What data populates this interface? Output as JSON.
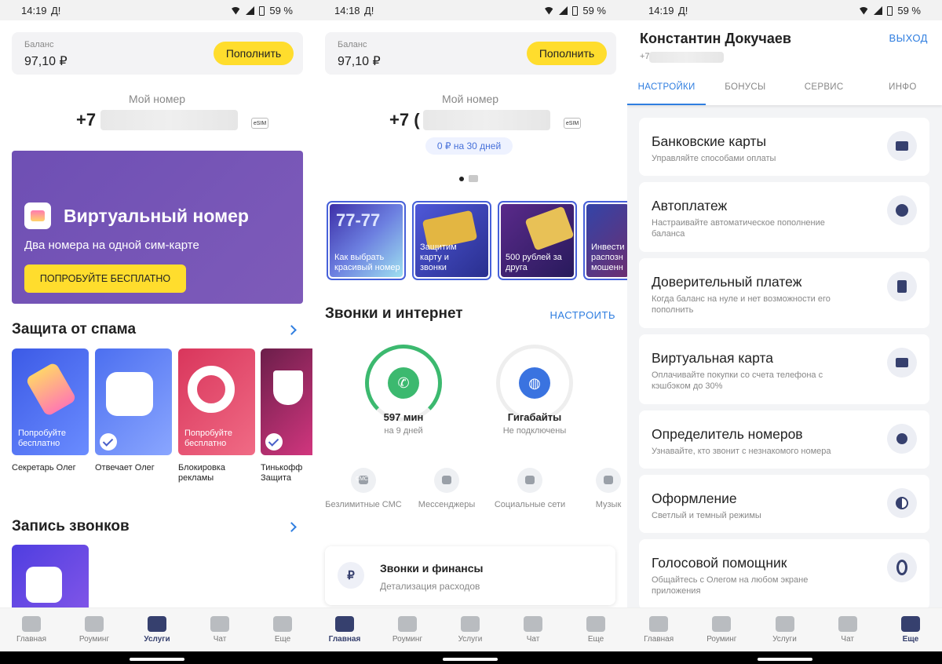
{
  "screens": [
    {
      "status": {
        "time": "14:19",
        "indicator": "Д!",
        "battery": "59 %"
      },
      "balance": {
        "label": "Баланс",
        "value": "97,10 ₽",
        "topup": "Пополнить"
      },
      "my_number": {
        "label": "Мой номер",
        "prefix": "+7",
        "esim": "eSIM"
      },
      "banner": {
        "title": "Виртуальный номер",
        "subtitle": "Два номера на одной сим-карте",
        "button": "ПОПРОБУЙТЕ БЕСПЛАТНО"
      },
      "spam": {
        "title": "Защита от спама",
        "tiles": [
          {
            "overlay": "Попробуйте бесплатно",
            "label": "Секретарь Олег"
          },
          {
            "overlay": "",
            "label": "Отвечает Олег"
          },
          {
            "overlay": "Попробуйте бесплатно",
            "label": "Блокировка рекламы"
          },
          {
            "overlay": "",
            "label": "Тинькофф Защита"
          }
        ]
      },
      "recording": {
        "title": "Запись звонков"
      },
      "nav": {
        "active": 2
      }
    },
    {
      "status": {
        "time": "14:18",
        "indicator": "Д!",
        "battery": "59 %"
      },
      "balance": {
        "label": "Баланс",
        "value": "97,10 ₽",
        "topup": "Пополнить"
      },
      "my_number": {
        "label": "Мой номер",
        "prefix": "+7 (",
        "esim": "eSIM",
        "promo": "0 ₽ на 30 дней"
      },
      "stories": [
        "Как выбрать красивый номер",
        "Защитим карту и звонки",
        "500 рублей за друга",
        "Инвести распозн мошенн"
      ],
      "story_tags": {
        "number_art": "77-77"
      },
      "calls": {
        "title": "Звонки и интернет",
        "configure": "НАСТРОИТЬ"
      },
      "gauges": [
        {
          "value": "597 мин",
          "sub": "на 9 дней",
          "icon": "phone-icon",
          "color": "#3cb96f",
          "fill": 0.75
        },
        {
          "value": "Гигабайты",
          "sub": "Не подключены",
          "icon": "globe-icon",
          "color": "#3a73e0",
          "fill": 0
        }
      ],
      "options": [
        "Безлимитные СМС",
        "Мессенджеры",
        "Социальные сети",
        "Музык"
      ],
      "options_icon_text": "СМС",
      "finance": {
        "title": "Звонки и финансы",
        "subtitle": "Детализация расходов",
        "icon": "₽"
      },
      "nav": {
        "active": 0
      }
    },
    {
      "status": {
        "time": "14:19",
        "indicator": "Д!",
        "battery": "59 %"
      },
      "profile": {
        "name": "Константин Докучаев",
        "phone_prefix": "+7",
        "exit": "ВЫХОД"
      },
      "tabs": [
        "НАСТРОЙКИ",
        "БОНУСЫ",
        "СЕРВИС",
        "ИНФО"
      ],
      "settings": [
        {
          "title": "Банковские карты",
          "subtitle": "Управляйте способами оплаты"
        },
        {
          "title": "Автоплатеж",
          "subtitle": "Настраивайте автоматическое пополнение баланса"
        },
        {
          "title": "Доверительный платеж",
          "subtitle": "Когда баланс на нуле и нет возможности его пополнить"
        },
        {
          "title": "Виртуальная карта",
          "subtitle": "Оплачивайте покупки со счета телефона с кэшбэком до 30%"
        },
        {
          "title": "Определитель номеров",
          "subtitle": "Узнавайте, кто звонит с незнакомого номера"
        },
        {
          "title": "Оформление",
          "subtitle": "Светлый и темный режимы"
        },
        {
          "title": "Голосовой помощник",
          "subtitle": "Общайтесь с Олегом на любом экране приложения"
        }
      ],
      "nav": {
        "active": 4
      }
    }
  ],
  "nav_items": [
    "Главная",
    "Роуминг",
    "Услуги",
    "Чат",
    "Еще"
  ],
  "colors": {
    "accent_yellow": "#ffdd2d",
    "link_blue": "#2f7ee0",
    "nav_active": "#36406e",
    "banner_purple": "#6e4fb4"
  }
}
